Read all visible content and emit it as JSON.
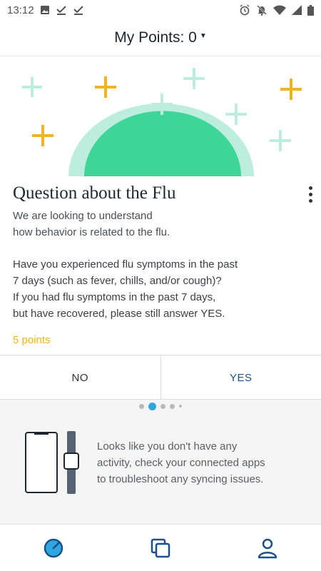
{
  "status_bar": {
    "time": "13:12",
    "left_icons": [
      "image-icon",
      "check-icon",
      "check-icon"
    ],
    "right_icons": [
      "alarm-icon",
      "notifications-off-icon",
      "wifi-icon",
      "signal-icon",
      "battery-icon"
    ]
  },
  "header": {
    "title": "My Points: 0"
  },
  "card": {
    "title": "Question about the Flu",
    "intro_line1": "We are looking to understand",
    "intro_line2": "how behavior is related to the flu.",
    "question_line1": "Have you experienced flu symptoms in the past",
    "question_line2": "7 days (such as fever, chills, and/or cough)?",
    "question_line3": "If you had flu symptoms in the past 7 days,",
    "question_line4": "but have recovered, please still answer YES.",
    "points": "5 points",
    "no_label": "NO",
    "yes_label": "YES"
  },
  "pager": {
    "count": 5,
    "active_index": 1
  },
  "activity": {
    "line1": "Looks like you don't have any",
    "line2": "activity, check your connected apps",
    "line3": "to troubleshoot any syncing issues."
  },
  "bottom_nav": {
    "items": [
      "dashboard-icon",
      "cards-icon",
      "profile-icon"
    ],
    "active_index": 0
  },
  "colors": {
    "accent_blue": "#1c4f8c",
    "active_blue": "#2fa6dd",
    "points_yellow": "#f0b323",
    "green": "#3dd598",
    "light_green": "#bdeedd",
    "device_gray": "#546273"
  }
}
